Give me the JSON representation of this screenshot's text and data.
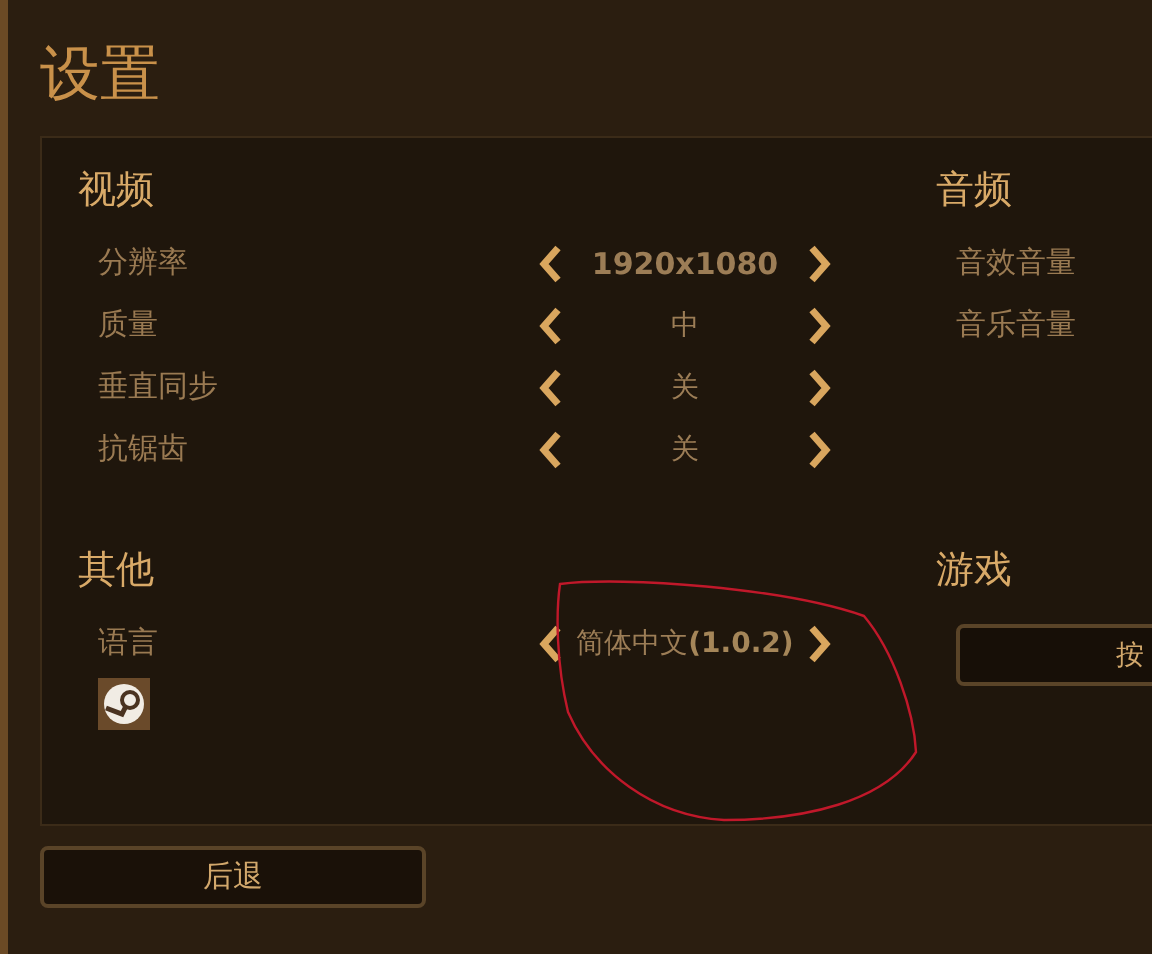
{
  "title": "设置",
  "rows": [
    {
      "left": {
        "heading": "视频",
        "items": [
          {
            "kind": "selector",
            "label": "分辨率",
            "value": "1920x1080"
          },
          {
            "kind": "selector",
            "label": "质量",
            "value": "中"
          },
          {
            "kind": "selector",
            "label": "垂直同步",
            "value": "关"
          },
          {
            "kind": "selector",
            "label": "抗锯齿",
            "value": "关"
          }
        ]
      },
      "right": {
        "heading": "音频",
        "items": [
          {
            "kind": "label",
            "label": "音效音量"
          },
          {
            "kind": "label",
            "label": "音乐音量"
          }
        ]
      }
    },
    {
      "left": {
        "heading": "其他",
        "items": [
          {
            "kind": "selector",
            "label": "语言",
            "value": "简体中文**(1.0.2)**"
          },
          {
            "kind": "logo"
          }
        ]
      },
      "right": {
        "heading": "游戏",
        "items": [
          {
            "kind": "button",
            "label": "按"
          }
        ]
      }
    }
  ],
  "back_button": "后退"
}
